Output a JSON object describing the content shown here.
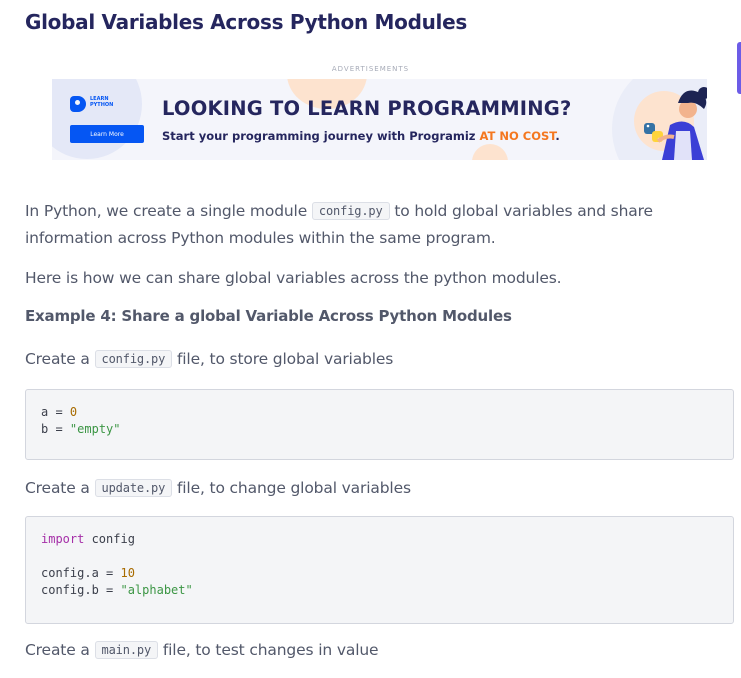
{
  "title": "Global Variables Across Python Modules",
  "ad": {
    "label": "ADVERTISEMENTS",
    "logo_line1": "LEARN",
    "logo_line2": "PYTHON",
    "button_label": "Learn More",
    "headline": "LOOKING TO LEARN PROGRAMMING?",
    "sub_prefix": "Start your programming journey with Programiz ",
    "sub_highlight": "AT NO COST",
    "sub_suffix": "."
  },
  "intro": {
    "before": "In Python, we create a single module ",
    "code": "config.py",
    "after": " to hold global variables and share information across Python modules within the same program."
  },
  "share_text": "Here is how we can share global variables across the python modules.",
  "example_heading": "Example 4: Share a global Variable Across Python Modules",
  "step1": {
    "before": "Create a ",
    "code": "config.py",
    "after": " file, to store global variables"
  },
  "code1": {
    "line1_var": "a",
    "line1_op": " = ",
    "line1_val": "0",
    "line2_var": "b",
    "line2_op": " = ",
    "line2_val": "\"empty\""
  },
  "step2": {
    "before": "Create a ",
    "code": "update.py",
    "after": " file, to change global variables"
  },
  "code2": {
    "line1_kw": "import",
    "line1_rest": " config",
    "line3_var": "config.a",
    "line3_op": " = ",
    "line3_val": "10",
    "line4_var": "config.b",
    "line4_op": " = ",
    "line4_val": "\"alphabet\""
  },
  "step3": {
    "before": "Create a ",
    "code": "main.py",
    "after": " file, to test changes in value"
  },
  "colors": {
    "title": "#25265e",
    "body_text": "#52586a",
    "brand_blue": "#0556f3",
    "highlight_orange": "#f4771f",
    "accent_purple": "#6c5ce7",
    "code_string": "#3c9645",
    "code_number": "#a86b00",
    "code_keyword": "#a52fa8"
  }
}
